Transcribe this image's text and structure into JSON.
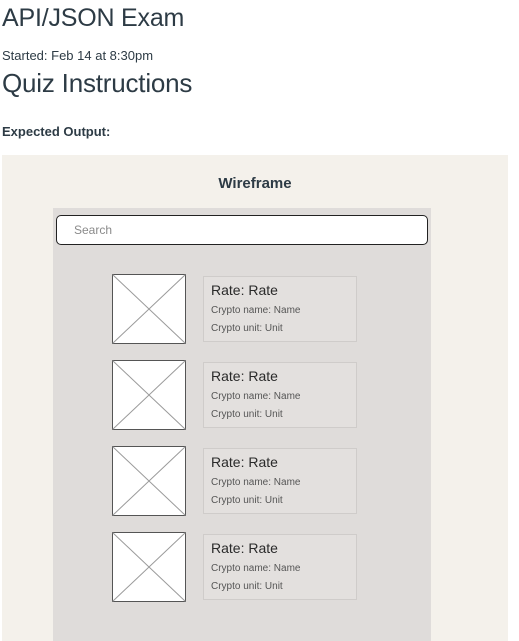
{
  "header": {
    "exam_title": "API/JSON Exam",
    "started": "Started: Feb 14 at 8:30pm",
    "section_title": "Quiz Instructions",
    "expected_label": "Expected Output:"
  },
  "wireframe": {
    "title": "Wireframe",
    "search_placeholder": "Search",
    "items": [
      {
        "rate": "Rate: Rate",
        "name": "Crypto name: Name",
        "unit": "Crypto unit: Unit"
      },
      {
        "rate": "Rate: Rate",
        "name": "Crypto name: Name",
        "unit": "Crypto unit: Unit"
      },
      {
        "rate": "Rate: Rate",
        "name": "Crypto name: Name",
        "unit": "Crypto unit: Unit"
      },
      {
        "rate": "Rate: Rate",
        "name": "Crypto name: Name",
        "unit": "Crypto unit: Unit"
      }
    ]
  },
  "colors": {
    "figure_bg": "#f4f1eb",
    "phone_bg": "#dfdcda",
    "text": "#2d3b45"
  }
}
